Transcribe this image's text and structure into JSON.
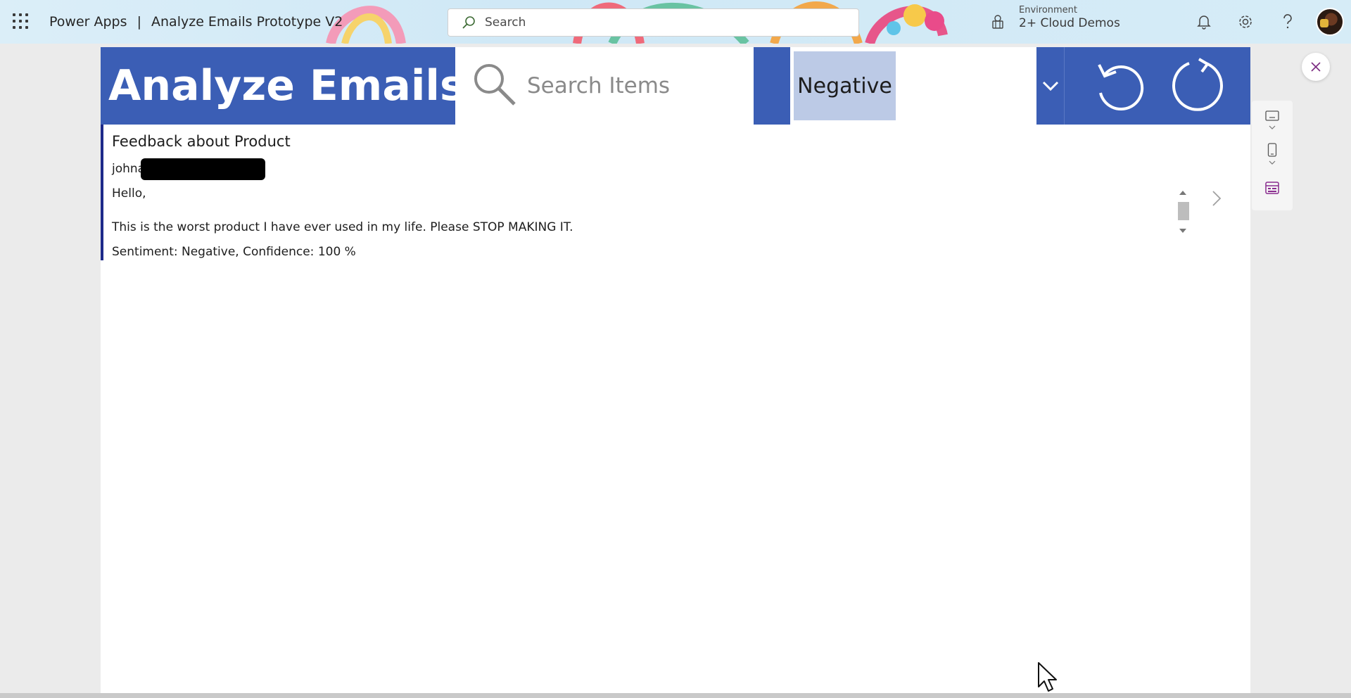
{
  "topbar": {
    "product": "Power Apps",
    "separator": "|",
    "app_name": "Analyze Emails Prototype V2",
    "search_placeholder": "Search",
    "environment_label": "Environment",
    "environment_name": "2+ Cloud Demos",
    "icons": [
      "waffle-icon",
      "search-icon",
      "environment-icon",
      "bell-icon",
      "gear-icon",
      "help-icon"
    ]
  },
  "app": {
    "title": "Analyze Emails",
    "search_placeholder": "Search Items",
    "filter_selected": "Negative",
    "accent_color": "#3b5eb5",
    "selected_bg": "#bccae6"
  },
  "gallery": {
    "items": [
      {
        "subject": "Feedback about Product",
        "from": "johna",
        "greeting": "Hello,",
        "body": "This is the worst product I have ever used in my life. Please STOP MAKING IT.",
        "sentiment": "Sentiment: Negative, Confidence: 100 %"
      }
    ]
  }
}
